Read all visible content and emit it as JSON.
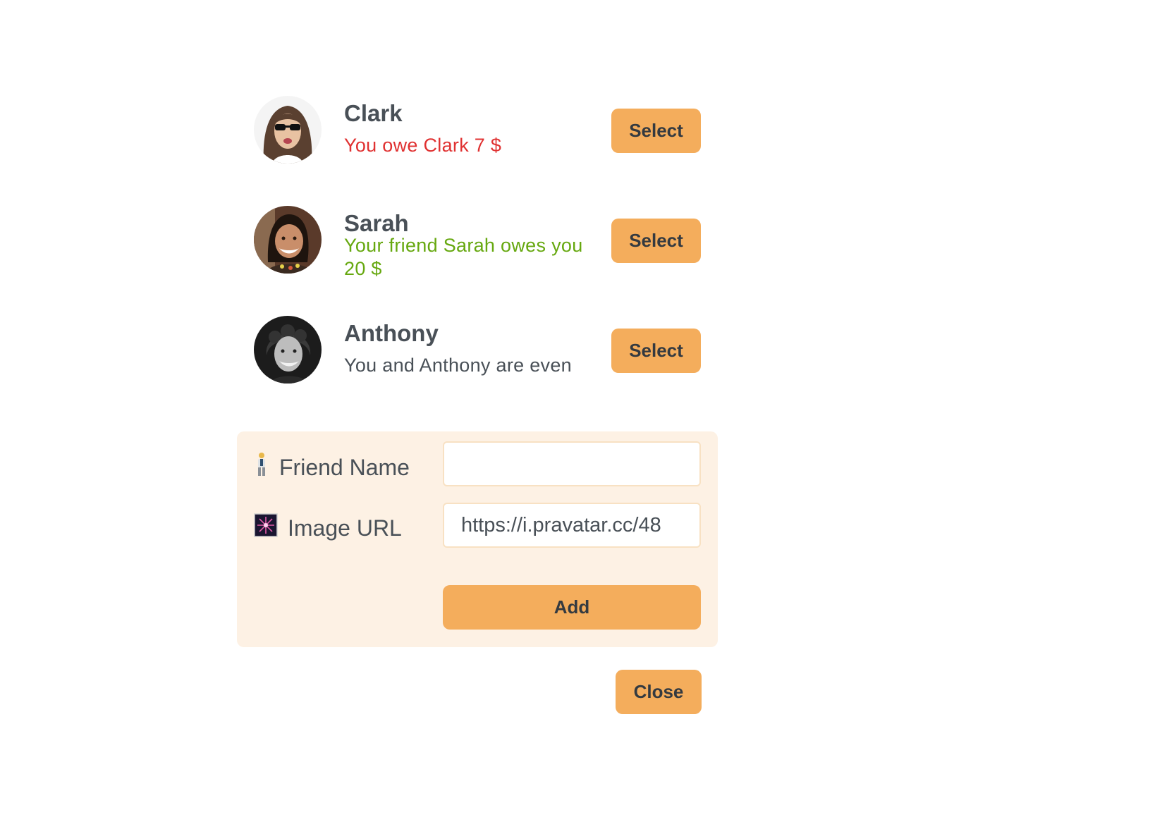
{
  "friends": [
    {
      "name": "Clark",
      "status": "You owe Clark 7 $",
      "status_color": "#e03131",
      "select_label": "Select"
    },
    {
      "name": "Sarah",
      "status": "Your friend Sarah owes you 20 $",
      "status_color": "#66a80f",
      "select_label": "Select"
    },
    {
      "name": "Anthony",
      "status": "You and Anthony are even",
      "status_color": "#495057",
      "select_label": "Select"
    }
  ],
  "form": {
    "name_label": "Friend Name",
    "name_icon": "person-emoji-icon",
    "name_value": "",
    "image_label": "Image URL",
    "image_icon": "fireworks-emoji-icon",
    "image_value": "https://i.pravatar.cc/48",
    "add_label": "Add"
  },
  "close_label": "Close",
  "colors": {
    "accent": "#f4ad5c",
    "form_background": "#fdf1e4",
    "owe_red": "#e03131",
    "owed_green": "#66a80f",
    "text": "#495057"
  }
}
